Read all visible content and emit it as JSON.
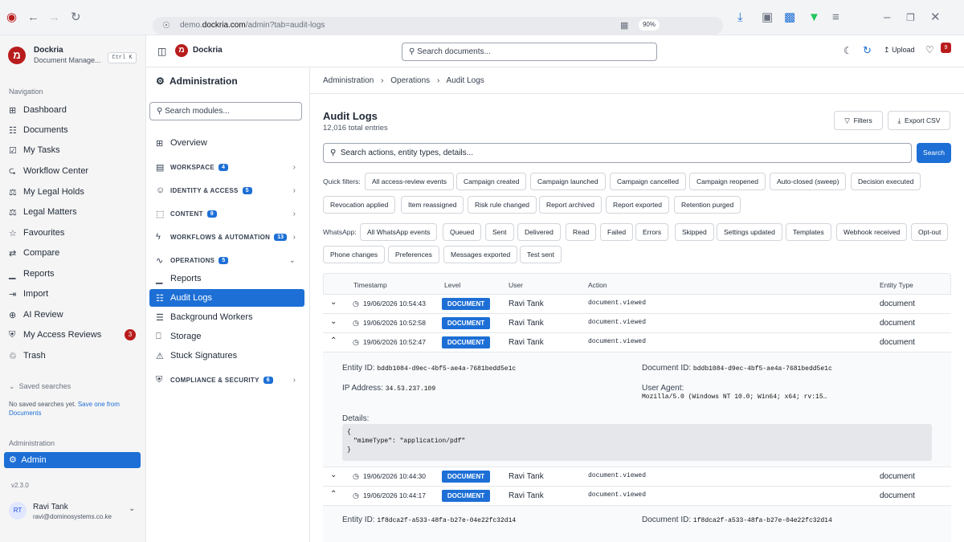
{
  "browser": {
    "url_prefix": "demo.",
    "url_domain": "dockria.com",
    "url_path": "/admin?tab=audit-logs",
    "zoom": "90%"
  },
  "sidebar": {
    "app_name": "Dockria",
    "app_sub": "Document Manage...",
    "shortcut": "Ctrl K",
    "nav_heading": "Navigation",
    "items": [
      {
        "label": "Dashboard",
        "icon": "grid-icon"
      },
      {
        "label": "Documents",
        "icon": "document-icon"
      },
      {
        "label": "My Tasks",
        "icon": "checkbox-icon"
      },
      {
        "label": "Workflow Center",
        "icon": "workflow-icon"
      },
      {
        "label": "My Legal Holds",
        "icon": "gavel-icon"
      },
      {
        "label": "Legal Matters",
        "icon": "scale-icon"
      },
      {
        "label": "Favourites",
        "icon": "star-icon"
      },
      {
        "label": "Compare",
        "icon": "compare-icon"
      },
      {
        "label": "Reports",
        "icon": "bar-chart-icon"
      },
      {
        "label": "Import",
        "icon": "import-icon"
      },
      {
        "label": "AI Review",
        "icon": "ai-icon"
      },
      {
        "label": "My Access Reviews",
        "icon": "shield-icon",
        "badge": "3"
      },
      {
        "label": "Trash",
        "icon": "trash-icon"
      }
    ],
    "saved_heading": "Saved searches",
    "saved_text": "No saved searches yet.",
    "saved_link": "Save one from Documents",
    "admin_heading": "Administration",
    "admin_item": "Admin",
    "version": "v2.3.0",
    "user": {
      "initials": "RT",
      "name": "Ravi Tank",
      "email": "ravi@dominosystems.co.ke"
    }
  },
  "topbar": {
    "brand": "Dockria",
    "search_placeholder": "Search documents...",
    "upload": "Upload",
    "notif_count": "9"
  },
  "admin": {
    "title": "Administration",
    "search_placeholder": "Search modules...",
    "overview": "Overview",
    "sections": [
      {
        "label": "WORKSPACE",
        "count": "4"
      },
      {
        "label": "IDENTITY & ACCESS",
        "count": "5"
      },
      {
        "label": "CONTENT",
        "count": "9"
      },
      {
        "label": "WORKFLOWS & AUTOMATION",
        "count": "13"
      },
      {
        "label": "OPERATIONS",
        "count": "5"
      }
    ],
    "ops_items": [
      "Reports",
      "Audit Logs",
      "Background Workers",
      "Storage",
      "Stuck Signatures"
    ],
    "compliance": {
      "label": "COMPLIANCE & SECURITY",
      "count": "6"
    }
  },
  "main": {
    "breadcrumb": [
      "Administration",
      "Operations",
      "Audit Logs"
    ],
    "title": "Audit Logs",
    "subtitle": "12,016 total entries",
    "filters_btn": "Filters",
    "export_btn": "Export CSV",
    "search_placeholder": "Search actions, entity types, details...",
    "search_btn": "Search",
    "quick_label": "Quick filters:",
    "quick_filters": [
      "All access-review events",
      "Campaign created",
      "Campaign launched",
      "Campaign cancelled",
      "Campaign reopened",
      "Auto-closed (sweep)",
      "Decision executed",
      "Revocation applied",
      "Item reassigned",
      "Risk rule changed",
      "Report archived",
      "Report exported",
      "Retention purged"
    ],
    "wa_label": "WhatsApp:",
    "wa_filters": [
      "All WhatsApp events",
      "Queued",
      "Sent",
      "Delivered",
      "Read",
      "Failed",
      "Errors",
      "Skipped",
      "Settings updated",
      "Templates",
      "Webhook received",
      "Opt-out",
      "Phone changes",
      "Preferences",
      "Messages exported",
      "Test sent"
    ],
    "columns": [
      "Timestamp",
      "Level",
      "User",
      "Action",
      "Entity Type"
    ],
    "rows": [
      {
        "ts": "19/06/2026 10:54:43",
        "level": "DOCUMENT",
        "user": "Ravi Tank",
        "action": "document.viewed",
        "entity": "document"
      },
      {
        "ts": "19/06/2026 10:52:58",
        "level": "DOCUMENT",
        "user": "Ravi Tank",
        "action": "document.viewed",
        "entity": "document"
      },
      {
        "ts": "19/06/2026 10:52:47",
        "level": "DOCUMENT",
        "user": "Ravi Tank",
        "action": "document.viewed",
        "entity": "document"
      },
      {
        "ts": "19/06/2026 10:44:30",
        "level": "DOCUMENT",
        "user": "Ravi Tank",
        "action": "document.viewed",
        "entity": "document"
      },
      {
        "ts": "19/06/2026 10:44:17",
        "level": "DOCUMENT",
        "user": "Ravi Tank",
        "action": "document.viewed",
        "entity": "document"
      }
    ],
    "detail1": {
      "entity_label": "Entity ID:",
      "entity_id": "bddb1084-d9ec-4bf5-ae4a-7681bedd5e1c",
      "doc_label": "Document ID:",
      "doc_id": "bddb1084-d9ec-4bf5-ae4a-7681bedd5e1c",
      "ip_label": "IP Address:",
      "ip": "34.53.237.109",
      "ua_label": "User Agent:",
      "ua": "Mozilla/5.0 (Windows NT 10.0; Win64; x64; rv:15…",
      "details_label": "Details:",
      "json_open": "{",
      "json_line": "\"mimeType\": \"application/pdf\"",
      "json_close": "}"
    },
    "detail2": {
      "entity_label": "Entity ID:",
      "entity_id": "1f8dca2f-a533-48fa-b27e-04e22fc32d14",
      "doc_label": "Document ID:",
      "doc_id": "1f8dca2f-a533-48fa-b27e-04e22fc32d14"
    }
  },
  "colors": {
    "accent": "#1d6fd6",
    "brand": "#b91c1c",
    "active_bg": "#1d6fd6"
  }
}
